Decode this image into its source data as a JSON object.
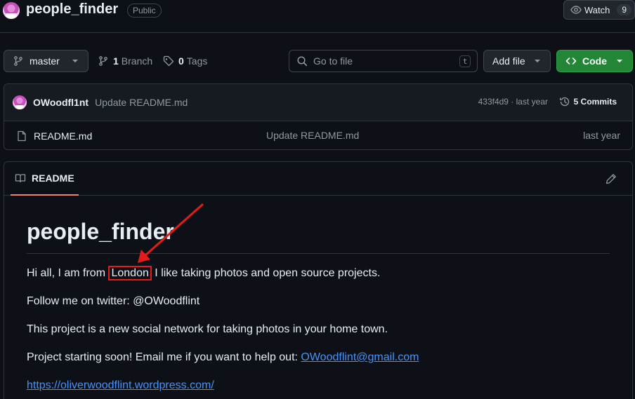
{
  "repo": {
    "name": "people_finder",
    "visibility": "Public",
    "watch_label": "Watch",
    "watch_count": "9"
  },
  "toolbar": {
    "branch": "master",
    "branch_count": "1",
    "branch_label": "Branch",
    "tag_count": "0",
    "tag_label": "Tags",
    "goto_placeholder": "Go to file",
    "goto_shortcut": "t",
    "add_file_label": "Add file",
    "code_label": "Code"
  },
  "latest_commit": {
    "author": "OWoodfl1nt",
    "message": "Update README.md",
    "hash_time": "433f4d9 · last year",
    "commits_label": "5 Commits"
  },
  "files": [
    {
      "name": "README.md",
      "commit": "Update README.md",
      "time": "last year"
    }
  ],
  "readme": {
    "tab_label": "README",
    "title": "people_finder",
    "line1_before": "Hi all, I am from ",
    "line1_highlight": "London",
    "line1_after": " I like taking photos and open source projects.",
    "line2": "Follow me on twitter: @OWoodflint",
    "line3": "This project is a new social network for taking photos in your home town.",
    "line4_text": "Project starting soon! Email me if you want to help out: ",
    "line4_email": "OWoodflint@gmail.com",
    "line5_link": "https://oliverwoodflint.wordpress.com/"
  },
  "colors": {
    "background": "#0d1117",
    "accent_green": "#238636",
    "link": "#4493f8",
    "annotation_red": "#e31b1b"
  },
  "icons": [
    "branch-icon",
    "tag-icon",
    "search-icon",
    "eye-icon",
    "code-icon",
    "history-icon",
    "file-icon",
    "book-icon",
    "pencil-icon"
  ]
}
